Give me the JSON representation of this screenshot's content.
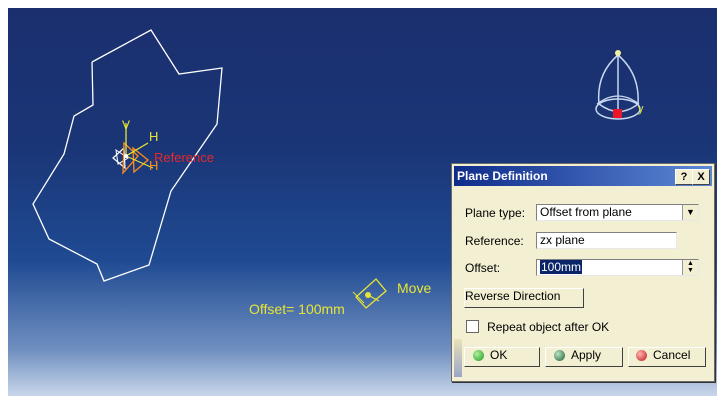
{
  "viewport": {
    "sketch_label": "Reference",
    "axis_v": "V",
    "axis_h": "H",
    "offset_readout": "Offset= 100mm",
    "move_label": "Move",
    "compass_axis": "y"
  },
  "dialog": {
    "title": "Plane Definition",
    "help_button": "?",
    "close_button": "X",
    "plane_type_label": "Plane type:",
    "plane_type_value": "Offset from plane",
    "reference_label": "Reference:",
    "reference_value": "zx plane",
    "offset_label": "Offset:",
    "offset_value": "100mm",
    "reverse_button": "Reverse Direction",
    "repeat_checkbox_label": "Repeat object after OK",
    "repeat_checked": false,
    "ok_button": "OK",
    "apply_button": "Apply",
    "cancel_button": "Cancel"
  },
  "colors": {
    "sketch_line": "#ffffff",
    "annotation_yellow": "#e6e632",
    "reference_red": "#e8282a",
    "ok_icon": "#23b323",
    "apply_icon": "#2f8a4a",
    "cancel_icon": "#d42424",
    "title_bar": "#0f2c8a"
  }
}
